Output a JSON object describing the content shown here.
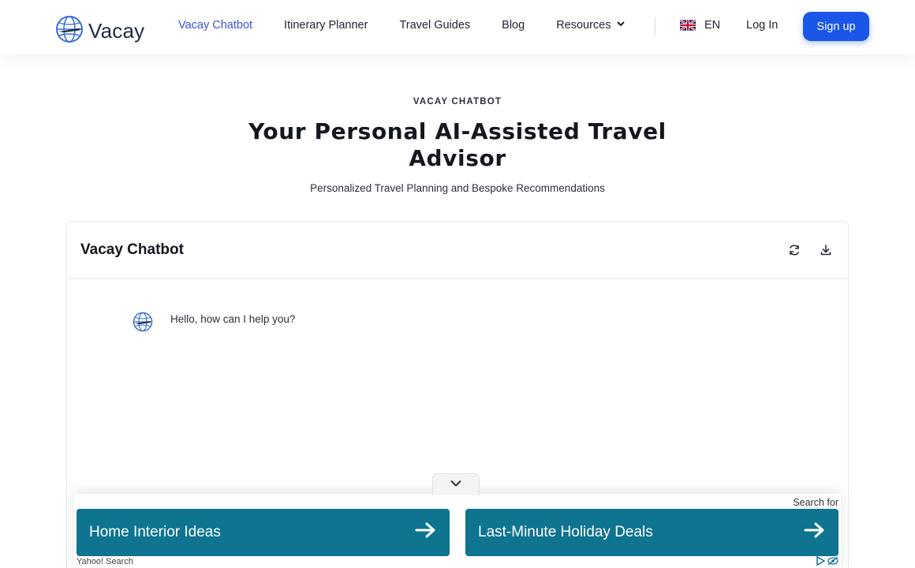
{
  "header": {
    "logo_text": "Vacay",
    "nav": [
      {
        "label": "Vacay Chatbot",
        "active": true
      },
      {
        "label": "Itinerary Planner"
      },
      {
        "label": "Travel Guides"
      },
      {
        "label": "Blog"
      },
      {
        "label": "Resources"
      }
    ],
    "language": "EN",
    "login_label": "Log In",
    "signup_label": "Sign up"
  },
  "hero": {
    "eyebrow": "VACAY CHATBOT",
    "title": "Your Personal AI-Assisted Travel Advisor",
    "subtitle": "Personalized Travel Planning and Bespoke Recommendations"
  },
  "chat": {
    "title": "Vacay Chatbot",
    "messages": [
      {
        "from": "bot",
        "text": "Hello, how can I help you?"
      }
    ]
  },
  "ads": {
    "search_for": "Search for",
    "items": [
      {
        "label": "Home Interior Ideas"
      },
      {
        "label": "Last-Minute Holiday Deals"
      }
    ],
    "provider": "Yahoo! Search"
  },
  "colors": {
    "accent": "#3a52d6",
    "signup_bg": "#1a56e8",
    "ad_bg": "#0e7490"
  }
}
